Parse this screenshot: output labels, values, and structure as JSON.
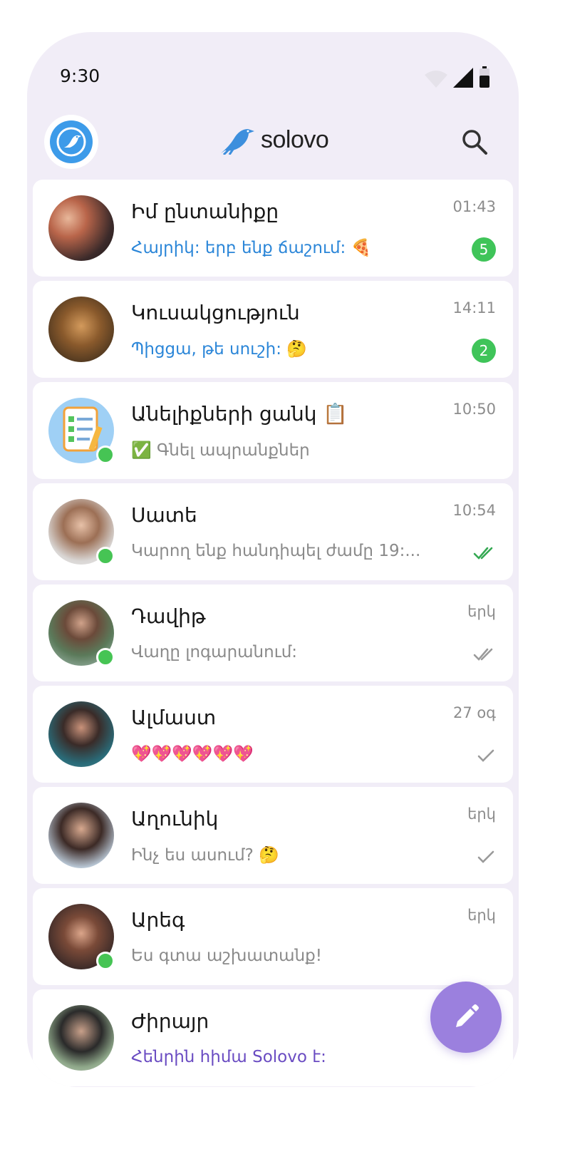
{
  "status_bar": {
    "time": "9:30"
  },
  "header": {
    "brand": "solovo"
  },
  "chats": [
    {
      "name": "Իմ ընտանիքը",
      "message": "Հայրիկ: երբ ենք ճաշում: 🍕",
      "time": "01:43",
      "unread": "5",
      "status": "unread",
      "online": false,
      "message_style": "blue"
    },
    {
      "name": "Կուսակցություն",
      "message": "Պիցցա, թե սուշի:  🤔",
      "time": "14:11",
      "unread": "2",
      "status": "unread",
      "online": false,
      "message_style": "blue"
    },
    {
      "name": "Անելիքների ցանկ 📋",
      "message": "✅ Գնել ապրանքներ",
      "time": "10:50",
      "unread": "",
      "status": "none",
      "online": true,
      "message_style": "gray"
    },
    {
      "name": "Սատե",
      "message": "Կարող ենք հանդիպել ժամը 19:...",
      "time": "10:54",
      "unread": "",
      "status": "read-green",
      "online": true,
      "message_style": "gray"
    },
    {
      "name": "Դավիթ",
      "message": "Վաղը լոգարանում:",
      "time": "երկ",
      "unread": "",
      "status": "read-gray",
      "online": true,
      "message_style": "gray"
    },
    {
      "name": "Ալմաստ",
      "message": "💖💖💖💖💖💖",
      "time": "27 օգ",
      "unread": "",
      "status": "sent",
      "online": false,
      "message_style": "gray"
    },
    {
      "name": "Աղունիկ",
      "message": "Ինչ ես ասում? 🤔",
      "time": "երկ",
      "unread": "",
      "status": "sent",
      "online": false,
      "message_style": "gray"
    },
    {
      "name": "Արեգ",
      "message": "Ես գտա աշխատանք!",
      "time": "երկ",
      "unread": "",
      "status": "none",
      "online": true,
      "message_style": "gray"
    },
    {
      "name": "Ժիրայր",
      "message": "Հենրին հիմա Solovo է:",
      "time": "",
      "unread": "",
      "status": "none",
      "online": false,
      "message_style": "purple"
    }
  ],
  "colors": {
    "accent": "#3d9be9",
    "fab": "#9b80de",
    "badge": "#3fc459",
    "background": "#f1edf7"
  },
  "icons": {
    "search": "search-icon",
    "compose": "pencil-icon",
    "brand": "bird-icon"
  }
}
